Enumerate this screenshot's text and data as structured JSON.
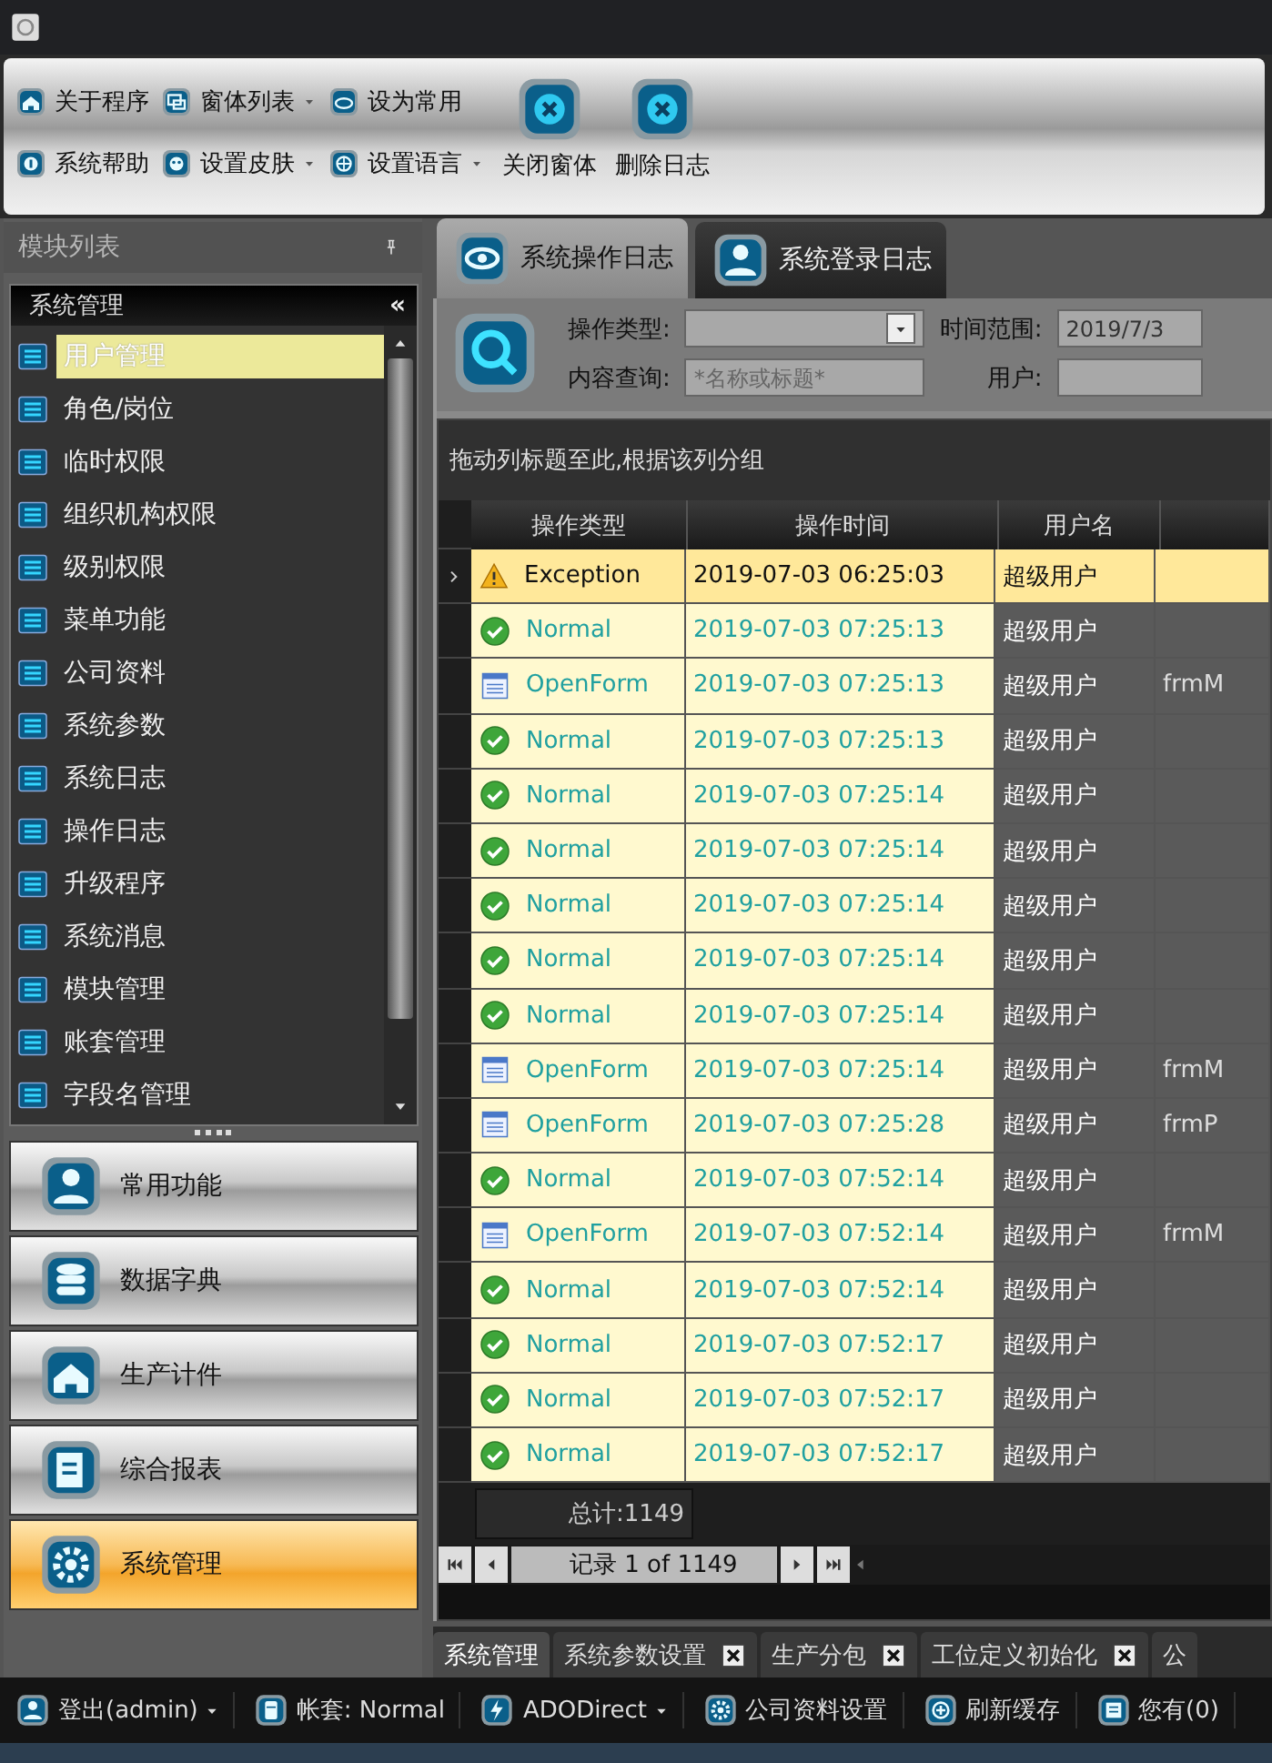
{
  "ribbon": {
    "small_buttons": [
      {
        "label": "关于程序",
        "dropdown": false
      },
      {
        "label": "窗体列表",
        "dropdown": true
      },
      {
        "label": "设为常用",
        "dropdown": false
      },
      {
        "label": "系统帮助",
        "dropdown": false
      },
      {
        "label": "设置皮肤",
        "dropdown": true
      },
      {
        "label": "设置语言",
        "dropdown": true
      }
    ],
    "large_buttons": [
      {
        "label": "关闭窗体"
      },
      {
        "label": "删除日志"
      }
    ]
  },
  "module_panel": {
    "title": "模块列表",
    "group": {
      "title": "系统管理",
      "collapse": "«"
    },
    "items": [
      {
        "label": "用户管理",
        "selected": true
      },
      {
        "label": "角色/岗位",
        "selected": false
      },
      {
        "label": "临时权限",
        "selected": false
      },
      {
        "label": "组织机构权限",
        "selected": false
      },
      {
        "label": "级别权限",
        "selected": false
      },
      {
        "label": "菜单功能",
        "selected": false
      },
      {
        "label": "公司资料",
        "selected": false
      },
      {
        "label": "系统参数",
        "selected": false
      },
      {
        "label": "系统日志",
        "selected": false
      },
      {
        "label": "操作日志",
        "selected": false
      },
      {
        "label": "升级程序",
        "selected": false
      },
      {
        "label": "系统消息",
        "selected": false
      },
      {
        "label": "模块管理",
        "selected": false
      },
      {
        "label": "账套管理",
        "selected": false
      },
      {
        "label": "字段名管理",
        "selected": false
      }
    ],
    "nav_buttons": [
      {
        "label": "常用功能",
        "selected": false
      },
      {
        "label": "数据字典",
        "selected": false
      },
      {
        "label": "生产计件",
        "selected": false
      },
      {
        "label": "综合报表",
        "selected": false
      },
      {
        "label": "系统管理",
        "selected": true
      }
    ]
  },
  "tabs": [
    {
      "label": "系统操作日志",
      "selected": true
    },
    {
      "label": "系统登录日志",
      "selected": false
    }
  ],
  "filter": {
    "fields": [
      {
        "label": "操作类型:",
        "kind": "dropdown"
      },
      {
        "label": "时间范围:",
        "kind": "text",
        "value": "2019/7/3"
      },
      {
        "label": "内容查询:",
        "kind": "text",
        "placeholder": "*名称或标题*"
      },
      {
        "label": "用户:",
        "kind": "text"
      }
    ]
  },
  "table": {
    "group_hint": "拖动列标题至此,根据该列分组",
    "columns": [
      "操作类型",
      "操作时间",
      "用户名"
    ],
    "rows": [
      {
        "type": "Exception",
        "time": "2019-07-03 06:25:03",
        "user": "超级用户",
        "selected": true
      },
      {
        "type": "Normal",
        "time": "2019-07-03 07:25:13",
        "user": "超级用户",
        "selected": false
      },
      {
        "type": "OpenForm",
        "time": "2019-07-03 07:25:13",
        "user": "超级用户",
        "column_4": "frmM",
        "selected": false
      },
      {
        "type": "Normal",
        "time": "2019-07-03 07:25:13",
        "user": "超级用户",
        "selected": false
      },
      {
        "type": "Normal",
        "time": "2019-07-03 07:25:14",
        "user": "超级用户",
        "selected": false
      },
      {
        "type": "Normal",
        "time": "2019-07-03 07:25:14",
        "user": "超级用户",
        "selected": false
      },
      {
        "type": "Normal",
        "time": "2019-07-03 07:25:14",
        "user": "超级用户",
        "selected": false
      },
      {
        "type": "Normal",
        "time": "2019-07-03 07:25:14",
        "user": "超级用户",
        "selected": false
      },
      {
        "type": "Normal",
        "time": "2019-07-03 07:25:14",
        "user": "超级用户",
        "selected": false
      },
      {
        "type": "OpenForm",
        "time": "2019-07-03 07:25:14",
        "user": "超级用户",
        "column_4": "frmM",
        "selected": false
      },
      {
        "type": "OpenForm",
        "time": "2019-07-03 07:25:28",
        "user": "超级用户",
        "column_4": "frmP",
        "selected": false
      },
      {
        "type": "Normal",
        "time": "2019-07-03 07:52:14",
        "user": "超级用户",
        "selected": false
      },
      {
        "type": "OpenForm",
        "time": "2019-07-03 07:52:14",
        "user": "超级用户",
        "column_4": "frmM",
        "selected": false
      },
      {
        "type": "Normal",
        "time": "2019-07-03 07:52:14",
        "user": "超级用户",
        "selected": false
      },
      {
        "type": "Normal",
        "time": "2019-07-03 07:52:17",
        "user": "超级用户",
        "selected": false
      },
      {
        "type": "Normal",
        "time": "2019-07-03 07:52:17",
        "user": "超级用户",
        "selected": false
      },
      {
        "type": "Normal",
        "time": "2019-07-03 07:52:17",
        "user": "超级用户",
        "selected": false
      }
    ],
    "total": "总计:1149",
    "navigator": "记录 1 of 1149"
  },
  "document_tabs": [
    {
      "label": "系统管理",
      "closable": false,
      "selected": true
    },
    {
      "label": "系统参数设置",
      "closable": true,
      "selected": false
    },
    {
      "label": "生产分包",
      "closable": true,
      "selected": false
    },
    {
      "label": "工位定义初始化",
      "closable": true,
      "selected": false
    },
    {
      "label": "公",
      "closable": false,
      "selected": false
    }
  ],
  "status_bar": [
    {
      "label": "登出(admin)",
      "dropdown": true
    },
    {
      "label": "帐套: Normal",
      "dropdown": false
    },
    {
      "label": "ADODirect",
      "dropdown": true
    },
    {
      "label": "公司资料设置",
      "dropdown": false
    },
    {
      "label": "刷新缓存",
      "dropdown": false
    },
    {
      "label": "您有(0)",
      "dropdown": false
    }
  ]
}
